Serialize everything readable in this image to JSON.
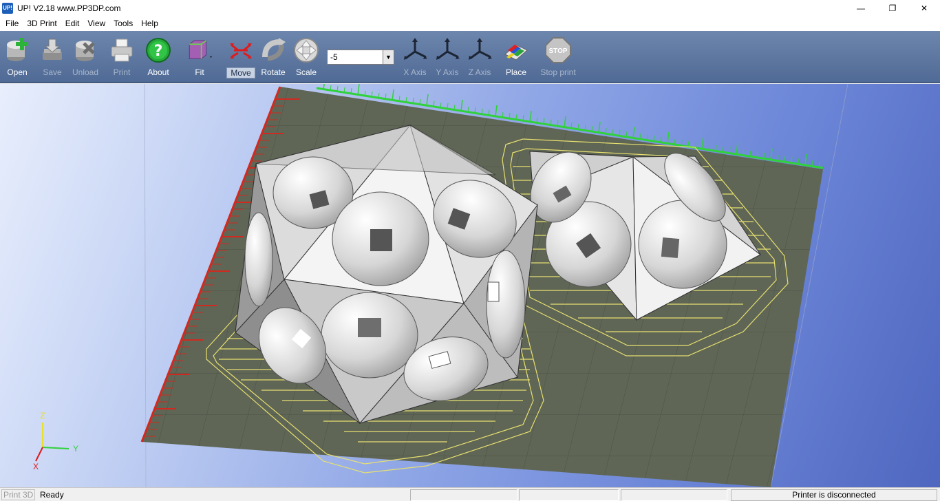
{
  "window": {
    "app_icon_text": "UP!",
    "title": "UP!  V2.18 www.PP3DP.com",
    "minimize_glyph": "—",
    "restore_glyph": "❐",
    "close_glyph": "✕"
  },
  "menu": [
    "File",
    "3D Print",
    "Edit",
    "View",
    "Tools",
    "Help"
  ],
  "toolbar": {
    "open": "Open",
    "save": "Save",
    "unload": "Unload",
    "print": "Print",
    "about": "About",
    "fit": "Fit",
    "move": "Move",
    "rotate": "Rotate",
    "scale": "Scale",
    "x_axis": "X Axis",
    "y_axis": "Y Axis",
    "z_axis": "Z Axis",
    "place": "Place",
    "stop_print": "Stop print",
    "stop_sign_text": "STOP",
    "about_glyph": "?",
    "step_value": "-5",
    "dropdown_arrow": "▼"
  },
  "viewport": {
    "axis_z": "Z",
    "axis_y": "Y",
    "axis_x": "X"
  },
  "status": {
    "mode": "Print 3D",
    "message": "Ready",
    "printer": "Printer is disconnected"
  },
  "colors": {
    "toolbar_bg": "#5c77a2",
    "bed_surface": "#5f6655",
    "ruler_red": "#d02a20",
    "ruler_green": "#2fd23a",
    "support_outline": "#e8e070",
    "model_gray": "#c9c9c9"
  }
}
